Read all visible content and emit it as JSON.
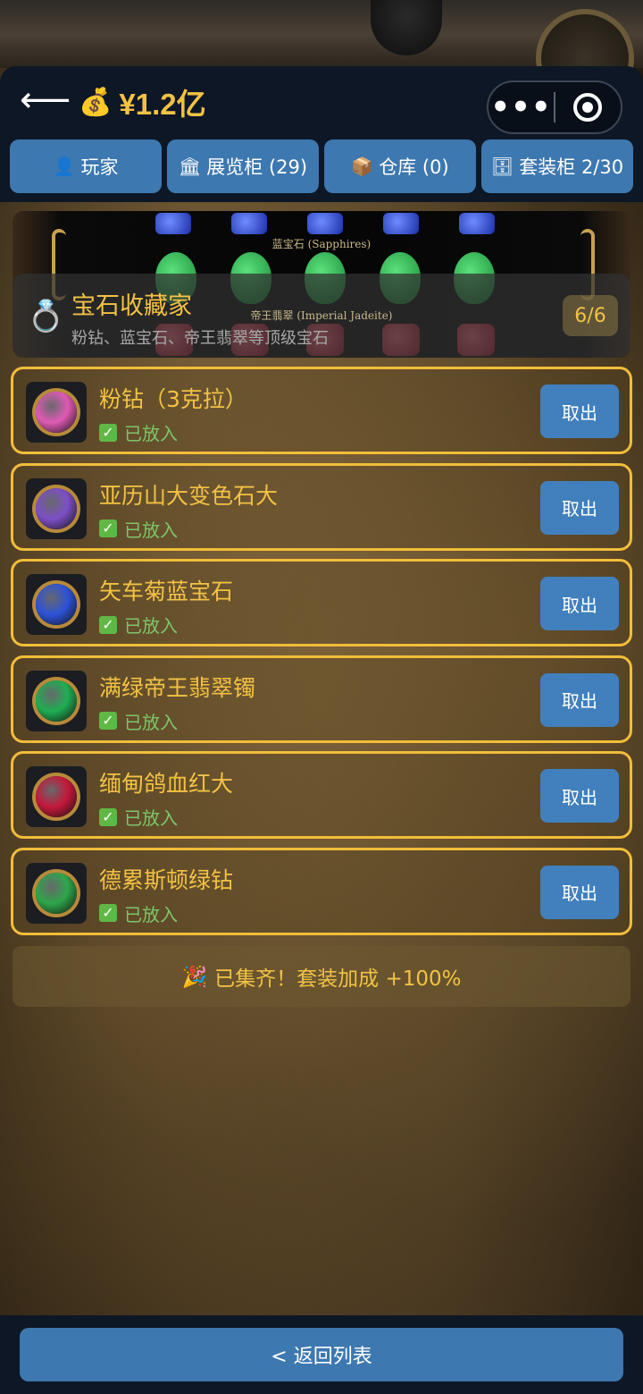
{
  "header": {
    "back_icon": "arrow-left-icon",
    "money_icon": "💰",
    "money_value": "¥1.2亿",
    "capsule_menu_icon": "•••",
    "capsule_close_icon": "target-icon"
  },
  "tabs": [
    {
      "icon": "👤",
      "label": "玩家"
    },
    {
      "icon": "🏛",
      "label": "展览柜 (29)"
    },
    {
      "icon": "📦",
      "label": "仓库 (0)"
    },
    {
      "icon": "🗄",
      "label": "套装柜 2/30"
    }
  ],
  "banner": {
    "image_label_top": "蓝宝石 (Sapphires)",
    "image_label_middle": "帝王翡翠 (Imperial Jadeite)",
    "icon": "💍",
    "title": "宝石收藏家",
    "subtitle": "粉钻、蓝宝石、帝王翡翠等顶级宝石",
    "count": "6/6"
  },
  "items": [
    {
      "name": "粉钻（3克拉）",
      "status": "已放入",
      "button": "取出",
      "gem_color": "#e05ab5"
    },
    {
      "name": "亚历山大变色石大",
      "status": "已放入",
      "button": "取出",
      "gem_color": "#7d4fc7"
    },
    {
      "name": "矢车菊蓝宝石",
      "status": "已放入",
      "button": "取出",
      "gem_color": "#2d52d8"
    },
    {
      "name": "满绿帝王翡翠镯",
      "status": "已放入",
      "button": "取出",
      "gem_color": "#1fae52"
    },
    {
      "name": "缅甸鸽血红大",
      "status": "已放入",
      "button": "取出",
      "gem_color": "#c4183a"
    },
    {
      "name": "德累斯顿绿钻",
      "status": "已放入",
      "button": "取出",
      "gem_color": "#2ea64a"
    }
  ],
  "status_check": "✓",
  "complete": {
    "icon": "🎉",
    "text": "已集齐！套装加成 +100%"
  },
  "footer": {
    "return_label": "< 返回列表"
  },
  "colors": {
    "accent_gold": "#f3c244",
    "button_blue": "#3d78b0",
    "header_navy": "#0e1726",
    "status_green": "#7ec56a"
  }
}
